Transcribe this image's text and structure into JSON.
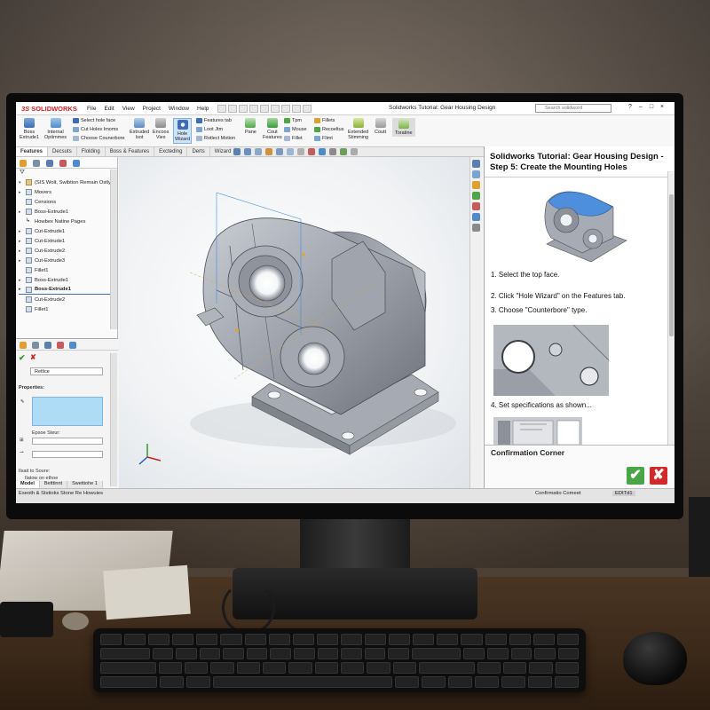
{
  "app": {
    "logo": "SOLIDWORKS",
    "logo_prefix": "3S",
    "menu": [
      "File",
      "Edit",
      "View",
      "Project",
      "Window",
      "Help"
    ],
    "document_title": "Solidworks Tutorial: Gear Housing Design",
    "search_placeholder": "Search solidword",
    "window_buttons": [
      "?",
      "–",
      "□",
      "×"
    ]
  },
  "ribbon": {
    "buttons": [
      {
        "label": "Boss\nExtrude1",
        "icon": "boss-extrude-icon"
      },
      {
        "label": "Internal\nOptimmes",
        "icon": "internal-icon"
      },
      {
        "label": "Extruded\nIsot",
        "icon": "extruded-icon"
      },
      {
        "label": "Encoos\nVies",
        "icon": "encoos-icon"
      },
      {
        "label": "Hole\nWizard",
        "icon": "hole-wizard-icon"
      },
      {
        "label": "Pane",
        "icon": "pane-icon"
      },
      {
        "label": "Cout\nFeatures",
        "icon": "features-icon"
      },
      {
        "label": "Extended\nStimming",
        "icon": "extended-icon"
      },
      {
        "label": "Coutt",
        "icon": "coutt-icon"
      },
      {
        "label": "Toratine",
        "icon": "toratine-icon"
      }
    ],
    "list1": [
      "Select hole face",
      "Cut Holes Imoms",
      "Choose Counerbore"
    ],
    "list2": [
      "Features tab",
      "Loot Jtm",
      "Rotlect Motion"
    ],
    "list3": [
      "Tpm",
      "Mouse",
      "Fillet"
    ],
    "list4": [
      "Fillets",
      "Recoeltus",
      "Flimt"
    ]
  },
  "tabs": [
    "Features",
    "Decsuts",
    "Flolding",
    "Boss & Features",
    "Excteding",
    "Derts",
    "Wizard"
  ],
  "feature_tree": {
    "header": "(SIS Wolt, Swibtion Remain Ostlyt)",
    "items": [
      {
        "label": "Movers",
        "arrow": "▸"
      },
      {
        "label": "Censions",
        "arrow": ""
      },
      {
        "label": "Boss-Extrude1",
        "arrow": "▸"
      },
      {
        "label": "Howbex Natine Pages",
        "arrow": ""
      },
      {
        "label": "Cut-Extrude1",
        "arrow": "▸"
      },
      {
        "label": "Cut-Extrude1",
        "arrow": "▸"
      },
      {
        "label": "Cut-Extrude2",
        "arrow": "▸"
      },
      {
        "label": "Cut-Extrude3",
        "arrow": "▸"
      },
      {
        "label": "Fillet1",
        "arrow": ""
      },
      {
        "label": "Boss-Extrude1",
        "arrow": "▸"
      },
      {
        "label": "Boss-Extrude1",
        "arrow": "▸"
      },
      {
        "label": "Cut-Extrude2",
        "arrow": ""
      },
      {
        "label": "Fillet1",
        "arrow": ""
      }
    ]
  },
  "property_manager": {
    "select_value": "Retlice",
    "properties_label": "Properties:",
    "field_label": "Epsoe Steur:",
    "footer_label": "Ilsait to Soure:",
    "footer_sub": "Ilatow on ethoe"
  },
  "bottom_tabs": [
    "Model",
    "Betttinnt",
    "Swettiohe 1"
  ],
  "status": {
    "left": "Eseoth & Ststioks Stone Re Howuies",
    "mid": "Confirmatio Comeet",
    "edit": "EDITd1"
  },
  "tutorial": {
    "title": "Solidworks Tutorial: Gear Housing Design - Step 5: Create the Mounting Holes",
    "steps": [
      "1. Select the top face.",
      "2. Click \"Hole Wizard\" on the Features tab.",
      "3. Choose \"Counterbore\" type.",
      "4. Set specifications as shown..."
    ],
    "confirm_label": "Confirmation Corner",
    "ok_symbol": "✔",
    "cancel_symbol": "✘"
  },
  "colors": {
    "accent": "#3d6db3",
    "logo_red": "#d31f26",
    "ok_green": "#4aa547",
    "cancel_red": "#d22a2a",
    "highlight_blue": "#aedcf7"
  }
}
